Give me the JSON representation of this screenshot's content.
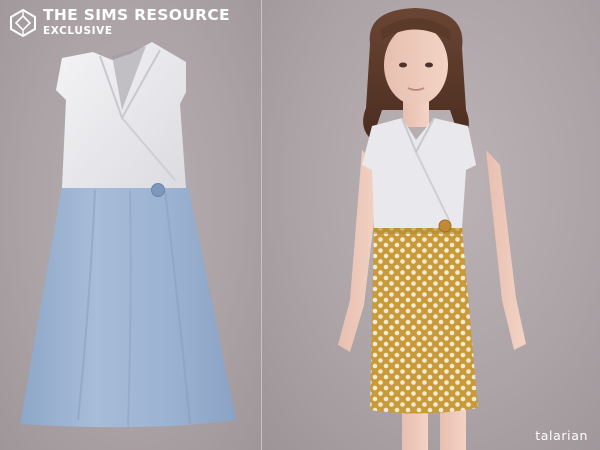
{
  "watermark": {
    "title": "THE SIMS RESOURCE",
    "subtitle": "EXCLUSIVE",
    "logo_icon": "tsr-diamond-icon"
  },
  "credit": "talarian",
  "colors": {
    "background": "#aaa1a5",
    "bodice": "#e9e8ec",
    "skirt_blue": "#9db3d2",
    "skirt_mustard": "#c99a3a",
    "dots": "#f3ead2",
    "button": "#c08a35"
  }
}
